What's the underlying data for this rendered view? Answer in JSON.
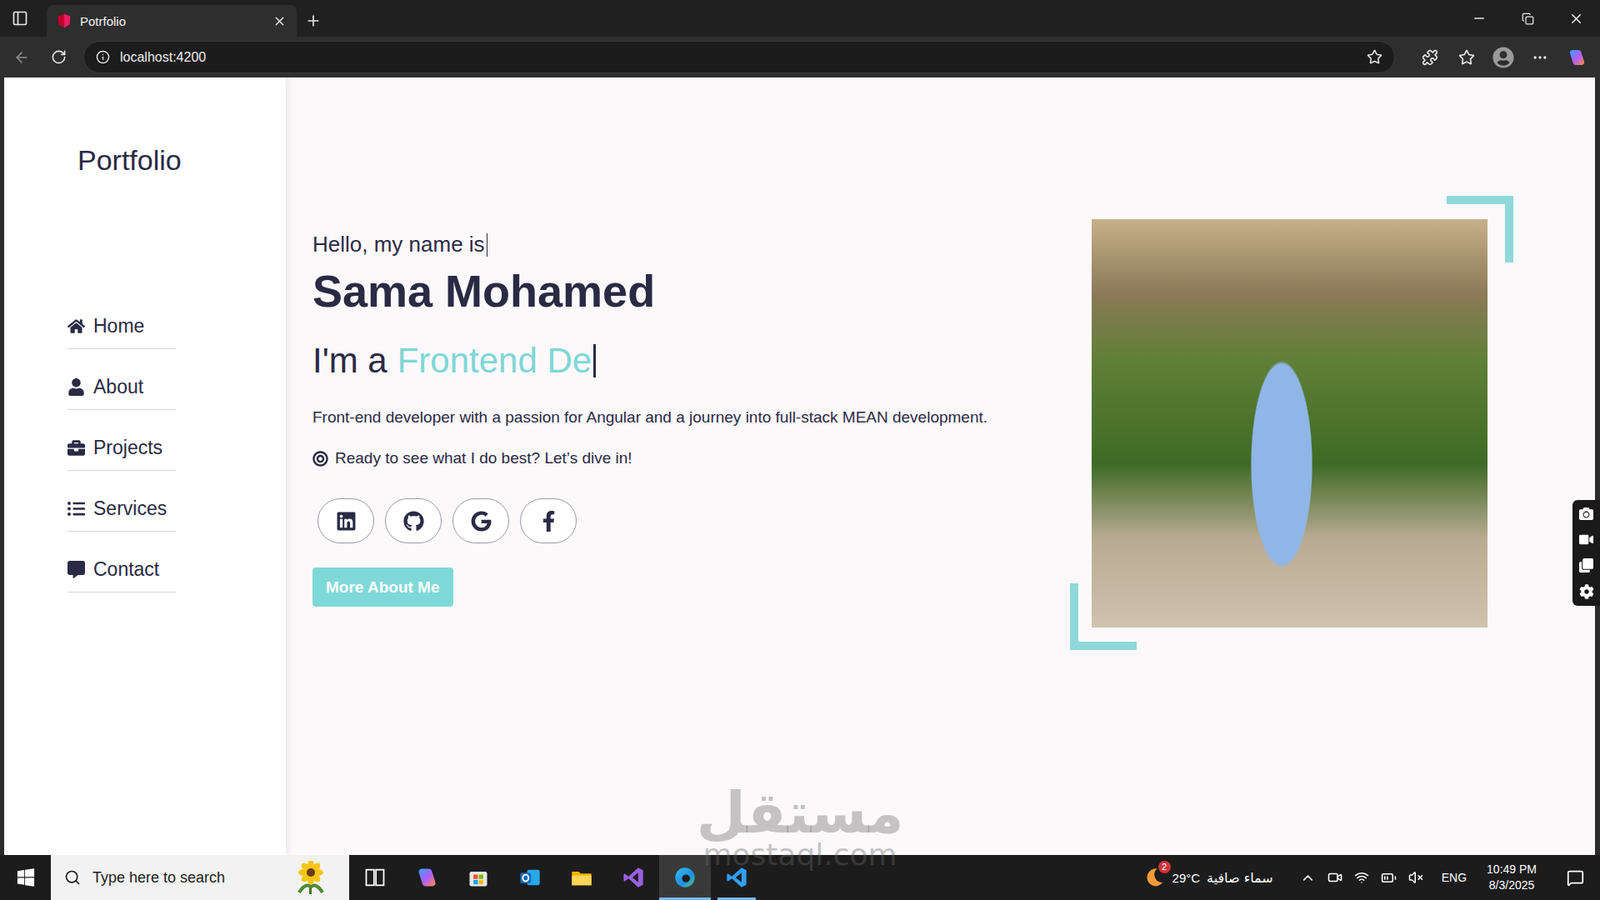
{
  "window": {
    "title": "Potrfolio"
  },
  "browser": {
    "tabs": [
      {
        "label": "Potrfolio",
        "selected": true
      }
    ],
    "address": "localhost:4200"
  },
  "sidebar": {
    "logo": "Portfolio",
    "items": [
      {
        "label": "Home",
        "kind": "home",
        "selected": false
      },
      {
        "label": "About",
        "kind": "about",
        "selected": false
      },
      {
        "label": "Projects",
        "kind": "projects",
        "selected": false
      },
      {
        "label": "Services",
        "kind": "services",
        "selected": false
      },
      {
        "label": "Contact",
        "kind": "contact",
        "selected": false
      }
    ]
  },
  "hero": {
    "greeting": "Hello, my name is",
    "name": "Sama Mohamed",
    "role_prefix": "I'm a",
    "role_typed": "Frontend De",
    "description": "Front-end developer with a passion for Angular and a journey into full-stack MEAN development.",
    "cta_line": "Ready to see what I do best? Let’s dive in!",
    "socials": [
      {
        "kind": "linkedin"
      },
      {
        "kind": "github"
      },
      {
        "kind": "google"
      },
      {
        "kind": "facebook"
      }
    ],
    "button": "More About Me"
  },
  "watermark": {
    "arabic": "مستقل",
    "latin": "mostaql.com"
  },
  "taskbar": {
    "search_placeholder": "Type here to search",
    "apps": [
      {
        "kind": "taskview",
        "open": false,
        "selected": false
      },
      {
        "kind": "copilot",
        "open": false,
        "selected": false
      },
      {
        "kind": "store",
        "open": false,
        "selected": false
      },
      {
        "kind": "outlook",
        "open": false,
        "selected": false
      },
      {
        "kind": "explorer",
        "open": false,
        "selected": false
      },
      {
        "kind": "visualstudio",
        "open": false,
        "selected": false
      },
      {
        "kind": "edge",
        "open": true,
        "selected": true
      },
      {
        "kind": "vscode",
        "open": true,
        "selected": false
      }
    ],
    "weather": {
      "badge": "2",
      "temperature": "29°C",
      "condition": "سماء صافية"
    },
    "language": "ENG",
    "time": "10:49 PM",
    "date": "8/3/2025"
  }
}
